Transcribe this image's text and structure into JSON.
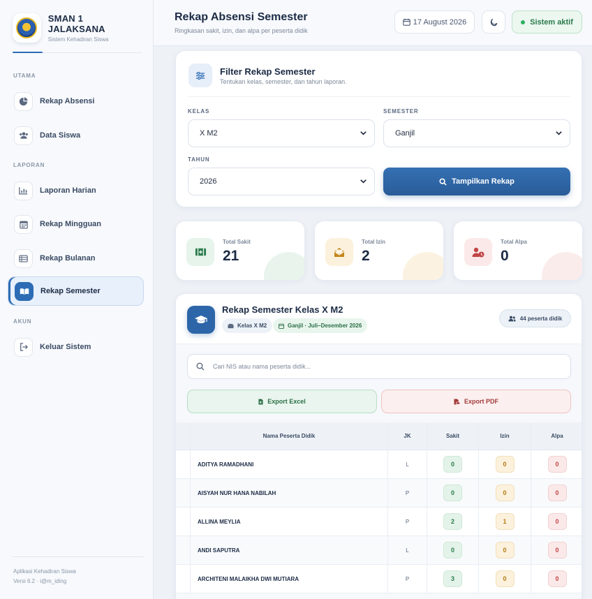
{
  "brand": {
    "name": "SMAN 1 JALAKSANA",
    "subtitle": "Sistem Kehadiran Siswa"
  },
  "sidebar": {
    "sections": [
      {
        "title": "UTAMA"
      },
      {
        "title": "LAPORAN"
      },
      {
        "title": "AKUN"
      }
    ],
    "items": [
      {
        "label": "Rekap Absensi",
        "icon": "pie-chart-icon"
      },
      {
        "label": "Data Siswa",
        "icon": "users-icon"
      },
      {
        "label": "Laporan Harian",
        "icon": "bar-chart-icon"
      },
      {
        "label": "Rekap Mingguan",
        "icon": "calendar-icon"
      },
      {
        "label": "Rekap Bulanan",
        "icon": "table-icon"
      },
      {
        "label": "Rekap Semester",
        "icon": "book-icon",
        "active": true
      },
      {
        "label": "Keluar Sistem",
        "icon": "logout-icon"
      }
    ],
    "footer": {
      "line1": "Aplikasi Kehadiran Siswa",
      "line2": "Versi 6.2 · i@m_iding"
    }
  },
  "header": {
    "title": "Rekap Absensi Semester",
    "subtitle": "Ringkasan sakit, izin, dan alpa per peserta didik",
    "date": "17 August 2026",
    "status": "Sistem aktif"
  },
  "filter": {
    "title": "Filter Rekap Semester",
    "subtitle": "Tentukan kelas, semester, dan tahun laporan.",
    "kelas_label": "KELAS",
    "kelas_value": "X M2",
    "semester_label": "SEMESTER",
    "semester_value": "Ganjil",
    "tahun_label": "TAHUN",
    "tahun_value": "2026",
    "button": "Tampilkan Rekap"
  },
  "stats": [
    {
      "label": "Total Sakit",
      "value": "21",
      "color": "#2b7a4b"
    },
    {
      "label": "Total Izin",
      "value": "2",
      "color": "#b57a16"
    },
    {
      "label": "Total Alpa",
      "value": "0",
      "color": "#c04545"
    }
  ],
  "recap": {
    "title": "Rekap Semester Kelas X M2",
    "chip_class": "Kelas X M2",
    "chip_period": "Ganjil · Juli–Desember 2026",
    "participants": "44 peserta didik",
    "search_placeholder": "Cari NIS atau nama peserta didik...",
    "export_excel": "Export Excel",
    "export_pdf": "Export PDF",
    "columns": [
      "Nama Peserta Didik",
      "JK",
      "Sakit",
      "Izin",
      "Alpa"
    ],
    "rows": [
      {
        "name": "ADITYA RAMADHANI",
        "jk": "L",
        "sakit": "0",
        "izin": "0",
        "alpa": "0"
      },
      {
        "name": "AISYAH NUR HANA NABILAH",
        "jk": "P",
        "sakit": "0",
        "izin": "0",
        "alpa": "0"
      },
      {
        "name": "ALLINA MEYLIA",
        "jk": "P",
        "sakit": "2",
        "izin": "1",
        "alpa": "0"
      },
      {
        "name": "ANDI SAPUTRA",
        "jk": "L",
        "sakit": "0",
        "izin": "0",
        "alpa": "0"
      },
      {
        "name": "ARCHITENI MALAIKHA DWI MUTIARA",
        "jk": "P",
        "sakit": "3",
        "izin": "0",
        "alpa": "0"
      }
    ]
  }
}
